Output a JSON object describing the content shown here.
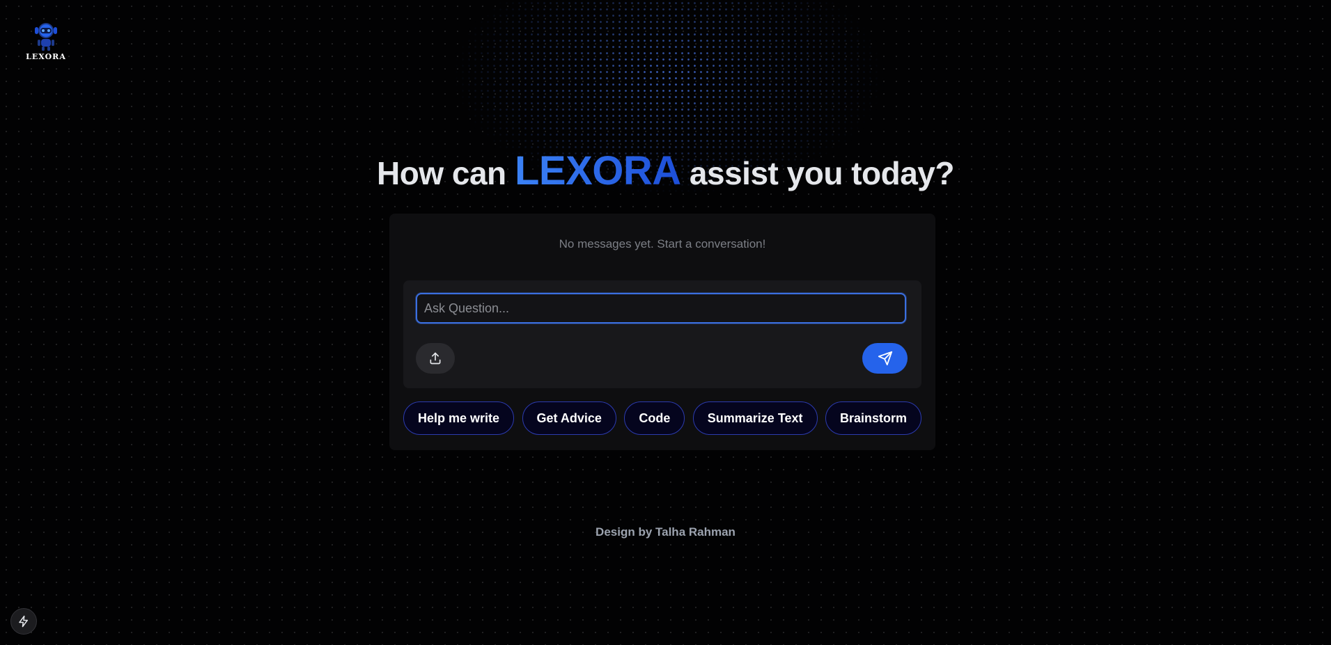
{
  "logo": {
    "name": "LEXORA",
    "icon": "robot-icon"
  },
  "headline": {
    "before": "How can",
    "brand": "LEXORA",
    "after": "assist you today?"
  },
  "chat": {
    "empty_message": "No messages yet. Start a conversation!",
    "input_placeholder": "Ask Question...",
    "input_value": ""
  },
  "actions": {
    "upload_icon": "upload-icon",
    "send_icon": "send-icon"
  },
  "suggestions": [
    "Help me write",
    "Get Advice",
    "Code",
    "Summarize Text",
    "Brainstorm"
  ],
  "footer": {
    "credit": "Design by Talha Rahman"
  },
  "dev_button": {
    "icon": "lightning-icon"
  },
  "colors": {
    "accent": "#2563eb",
    "background": "#020203",
    "panel": "#0e0e10",
    "chip_border": "#2c3bb0"
  }
}
